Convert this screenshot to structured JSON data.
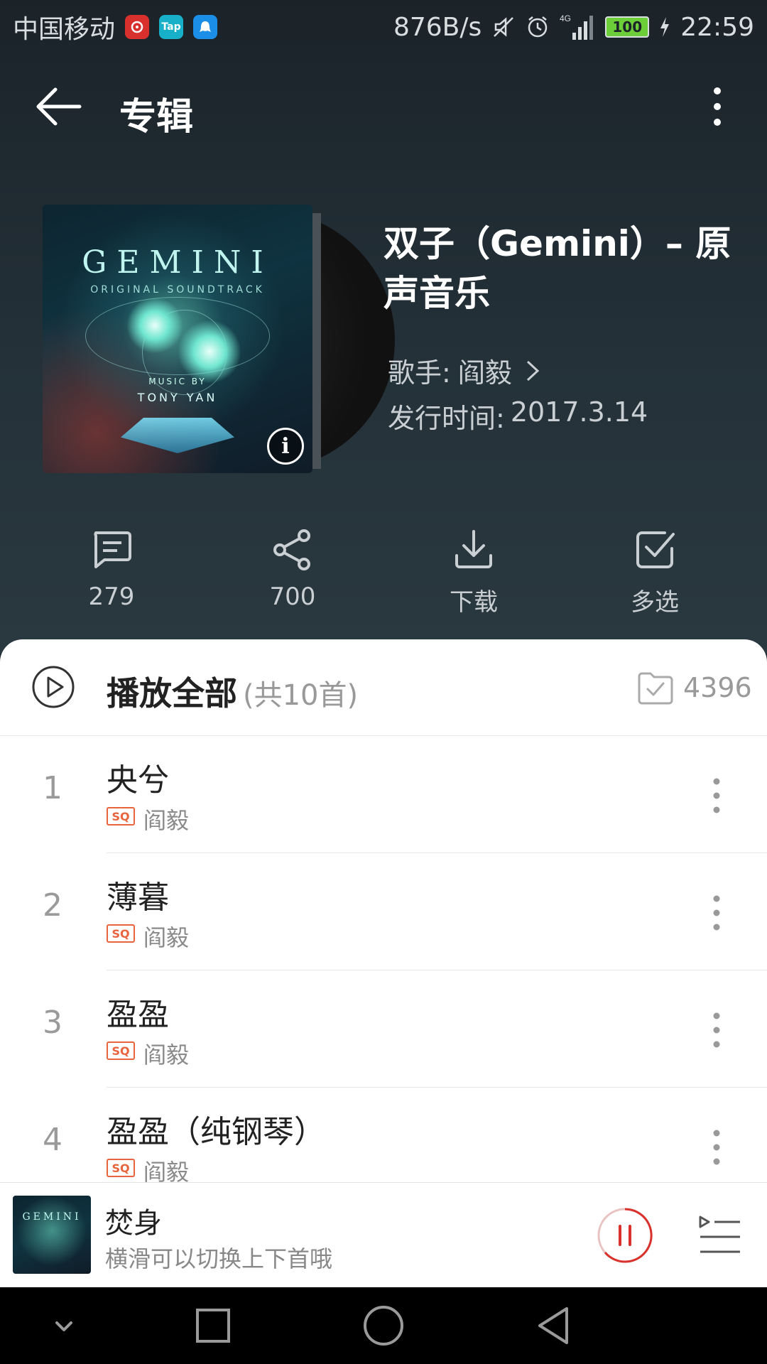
{
  "status_bar": {
    "carrier": "中国移动",
    "apps": [
      {
        "name": "netease-music-icon",
        "label": "",
        "color": "#d8302c"
      },
      {
        "name": "taptap-icon",
        "label": "Tap",
        "color": "#18b0c8"
      },
      {
        "name": "qq-icon",
        "label": "",
        "color": "#1b8ee8"
      }
    ],
    "speed": "876B/s",
    "battery": "100",
    "time": "22:59",
    "network": "4G"
  },
  "toolbar": {
    "title": "专辑"
  },
  "album": {
    "cover_title": "GEMINI",
    "cover_subtitle": "ORIGINAL SOUNDTRACK",
    "cover_music_by": "MUSIC BY",
    "cover_artist": "TONY YAN",
    "title": "双子（Gemini）– 原声音乐",
    "singer_label": "歌手:",
    "singer": "阎毅",
    "date_label": "发行时间:",
    "date": "2017.3.14"
  },
  "actions": [
    {
      "name": "comment",
      "label": "279"
    },
    {
      "name": "share",
      "label": "700"
    },
    {
      "name": "download",
      "label": "下载"
    },
    {
      "name": "multi-select",
      "label": "多选"
    }
  ],
  "list_header": {
    "play_all": "播放全部",
    "count": "(共10首)",
    "collect_count": "4396"
  },
  "tracks": [
    {
      "num": "1",
      "title": "央兮",
      "badge": "SQ",
      "artist": "阎毅"
    },
    {
      "num": "2",
      "title": "薄暮",
      "badge": "SQ",
      "artist": "阎毅"
    },
    {
      "num": "3",
      "title": "盈盈",
      "badge": "SQ",
      "artist": "阎毅"
    },
    {
      "num": "4",
      "title": "盈盈（纯钢琴）",
      "badge": "SQ",
      "artist": "阎毅"
    }
  ],
  "mini_player": {
    "title": "焚身",
    "hint": "横滑可以切换上下首哦",
    "cover_text": "GEMINI"
  },
  "colors": {
    "accent": "#d9312b",
    "sq_badge": "#e8643c"
  }
}
